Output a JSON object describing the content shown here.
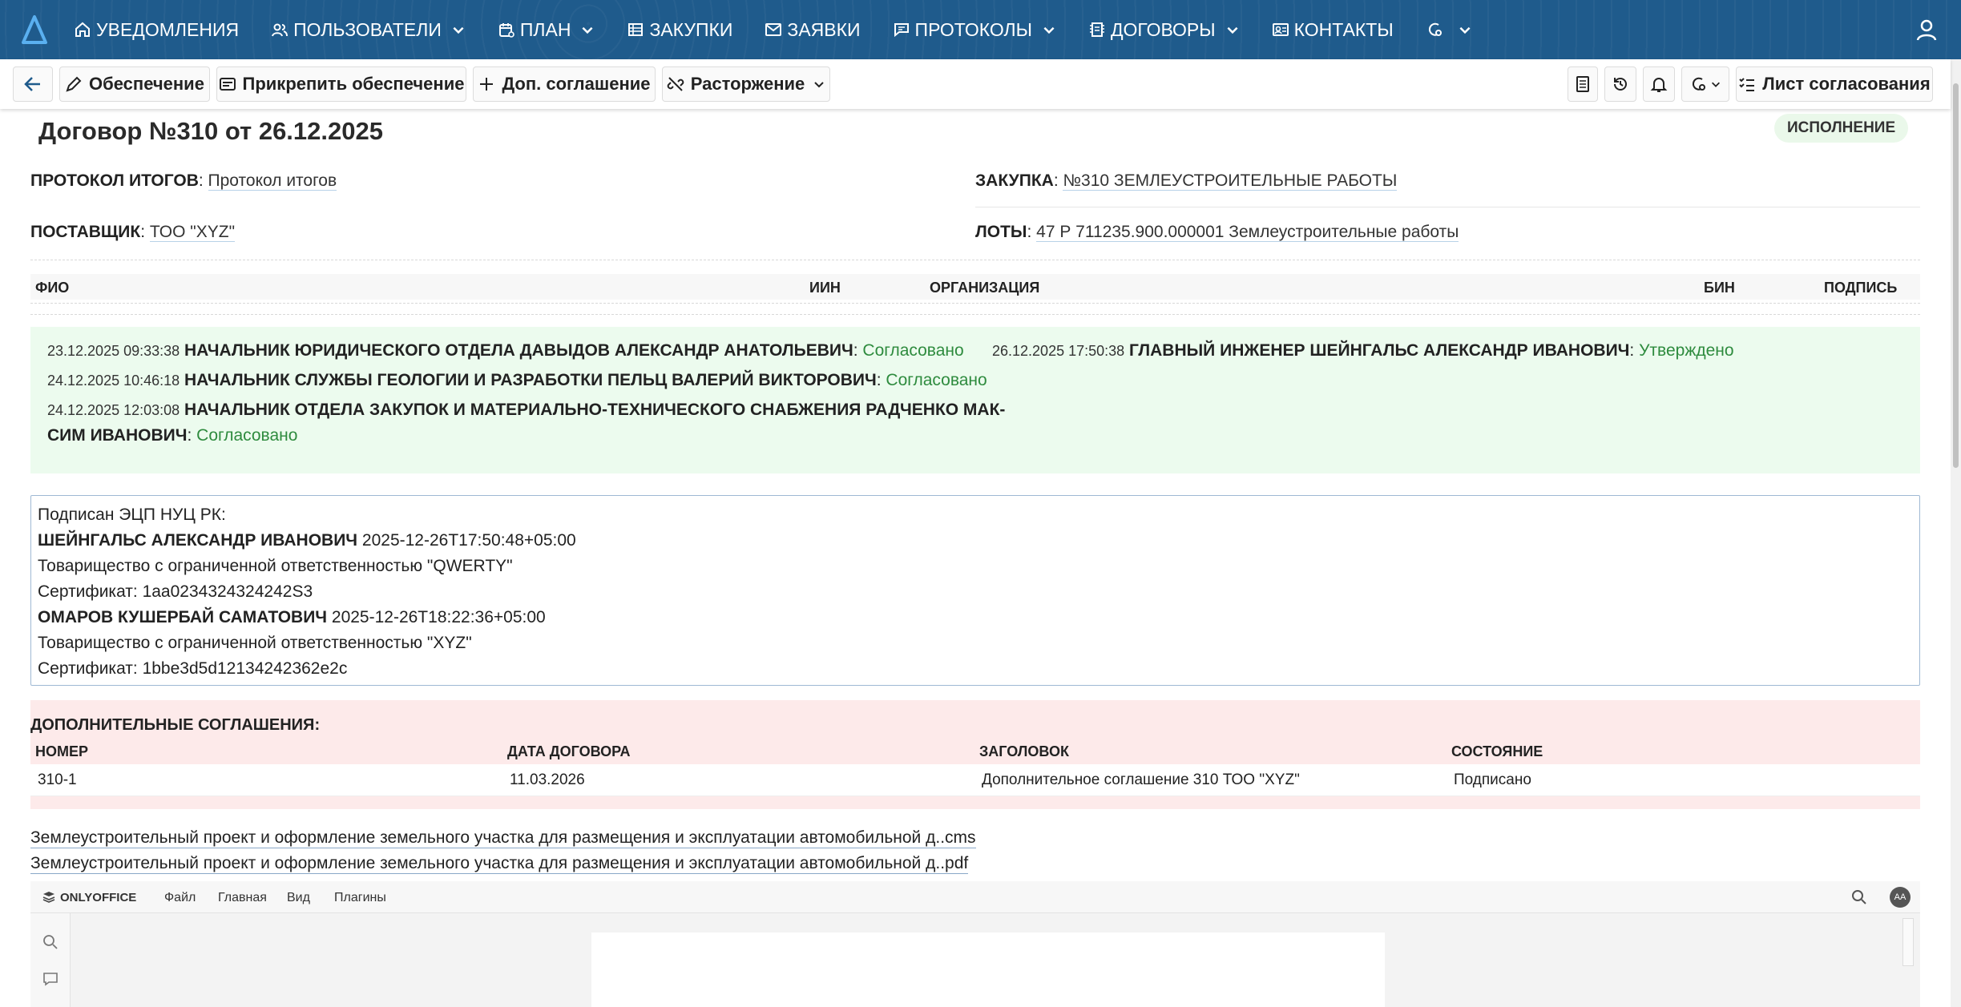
{
  "nav": {
    "items": [
      {
        "label": "УВЕДОМЛЕНИЯ",
        "icon": "home-icon",
        "dropdown": false
      },
      {
        "label": "ПОЛЬЗОВАТЕЛИ",
        "icon": "users-icon",
        "dropdown": true
      },
      {
        "label": "ПЛАН",
        "icon": "calendar-icon",
        "dropdown": true
      },
      {
        "label": "ЗАКУПКИ",
        "icon": "table-icon",
        "dropdown": false
      },
      {
        "label": "ЗАЯВКИ",
        "icon": "mail-icon",
        "dropdown": false
      },
      {
        "label": "ПРОТОКОЛЫ",
        "icon": "protocol-icon",
        "dropdown": true
      },
      {
        "label": "ДОГОВОРЫ",
        "icon": "contract-icon",
        "dropdown": true
      },
      {
        "label": "КОНТАКТЫ",
        "icon": "contacts-icon",
        "dropdown": false
      }
    ]
  },
  "toolbar": {
    "security": "Обеспечение",
    "attach_security": "Прикрепить обеспечение",
    "add_agreement": "Доп. соглашение",
    "termination": "Расторжение",
    "approval_sheet": "Лист согласования"
  },
  "contract": {
    "title": "Договор №310 от 26.12.2025",
    "status": "ИСПОЛНЕНИЕ",
    "protocol_label": "ПРОТОКОЛ ИТОГОВ",
    "protocol_value": "Протокол итогов",
    "purchase_label": "ЗАКУПКА",
    "purchase_value": "№310 ЗЕМЛЕУСТРОИТЕЛЬНЫЕ РАБОТЫ",
    "supplier_label": "ПОСТАВЩИК",
    "supplier_value": "ТОО \"XYZ\"",
    "lots_label": "ЛОТЫ",
    "lots_value": "47 Р 711235.900.000001 Землеустроительные работы"
  },
  "signers_table": {
    "columns": [
      "ФИО",
      "ИИН",
      "ОРГАНИЗАЦИЯ",
      "БИН",
      "ПОДПИСЬ"
    ]
  },
  "approvals": [
    {
      "ts": "23.12.2025 09:33:38",
      "who": "НАЧАЛЬНИК ЮРИДИЧЕСКОГО ОТДЕЛА ДАВЫДОВ АЛЕКСАНДР АНАТОЛЬЕВИЧ",
      "status": "Согласовано"
    },
    {
      "ts": "24.12.2025 10:46:18",
      "who": "НАЧАЛЬНИК СЛУЖБЫ ГЕОЛОГИИ И РАЗРАБОТКИ ПЕЛЬЦ ВАЛЕРИЙ ВИКТОРОВИЧ",
      "status": "Согласовано"
    },
    {
      "ts": "24.12.2025 12:03:08",
      "who": "НАЧАЛЬНИК ОТДЕЛА ЗАКУПОК И МАТЕРИАЛЬНО-ТЕХНИЧЕСКОГО СНАБЖЕНИЯ РАДЧЕНКО МАК-",
      "who2": "СИМ ИВАНОВИЧ",
      "status": "Согласовано"
    },
    {
      "ts": "26.12.2025 17:50:38",
      "who": "ГЛАВНЫЙ ИНЖЕНЕР ШЕЙНГАЛЬС АЛЕКСАНДР ИВАНОВИЧ",
      "status": "Утверждено"
    }
  ],
  "ecp": {
    "heading": "Подписан ЭЦП НУЦ РК:",
    "signer1_name": "ШЕЙНГАЛЬС АЛЕКСАНДР ИВАНОВИЧ",
    "signer1_time": "2025-12-26T17:50:48+05:00",
    "signer1_org": "Товарищество с ограниченной ответственностью \"QWERTY\"",
    "signer1_cert": "Сертификат: 1aa0234324324242S3",
    "signer2_name": "ОМАРОВ КУШЕРБАЙ САМАТОВИЧ",
    "signer2_time": "2025-12-26T18:22:36+05:00",
    "signer2_org": "Товарищество с ограниченной ответственностью \"XYZ\"",
    "signer2_cert": "Сертификат: 1bbe3d5d12134242362e2c"
  },
  "additional_agreements": {
    "heading": "ДОПОЛНИТЕЛЬНЫЕ СОГЛАШЕНИЯ",
    "columns": [
      "НОМЕР",
      "ДАТА ДОГОВОРА",
      "ЗАГОЛОВОК",
      "СОСТОЯНИЕ"
    ],
    "rows": [
      [
        "310-1",
        "11.03.2026",
        "Дополнительное соглашение 310 ТОО \"XYZ\"",
        "Подписано"
      ]
    ]
  },
  "files": [
    "Землеустроительный проект и оформление земельного участка для размещения и эксплуатации автомобильной д..cms",
    "Землеустроительный проект и оформление земельного участка для размещения и эксплуатации автомобильной д..pdf"
  ],
  "onlyoffice": {
    "brand": "ONLYOFFICE",
    "menu": [
      "Файл",
      "Главная",
      "Вид",
      "Плагины"
    ],
    "avatar": "AA"
  },
  "colors": {
    "nav_bg": "#1f5b8c",
    "approved_text": "#2e8b3e",
    "approvals_bg": "#ecfbee",
    "agreements_bg": "#fdeaea"
  }
}
